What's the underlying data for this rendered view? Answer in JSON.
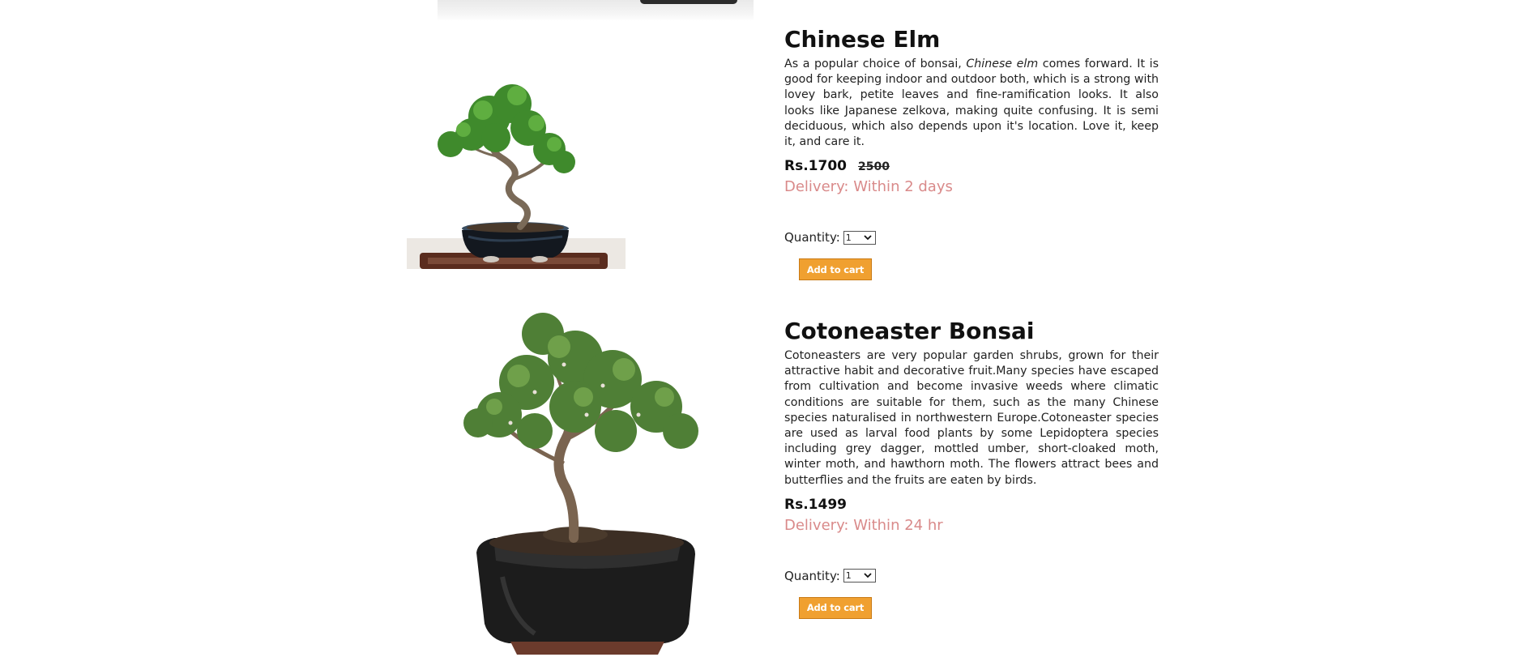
{
  "products": [
    {
      "id": "chinese-elm",
      "title": "Chinese Elm",
      "description_pre": "As a popular choice of bonsai, ",
      "description_em": "Chinese elm",
      "description_post": " comes forward. It is good for keeping indoor and outdoor both, which is a strong with lovey bark, petite leaves and fine-ramification looks. It also looks like Japanese zelkova, making quite confusing. It is semi deciduous, which also depends upon it's location. Love it, keep it, and care it.",
      "price": "Rs.1700",
      "old_price": "2500",
      "delivery": "Delivery: Within 2 days",
      "quantity_label": "Quantity:",
      "quantity_value": "1",
      "add_to_cart_label": "Add to cart"
    },
    {
      "id": "cotoneaster-bonsai",
      "title": "Cotoneaster Bonsai",
      "description": "Cotoneasters are very popular garden shrubs, grown for their attractive habit and decorative fruit.Many species have escaped from cultivation and become invasive weeds where climatic conditions are suitable for them, such as the many Chinese species naturalised in northwestern Europe.Cotoneaster species are used as larval food plants by some Lepidoptera species including grey dagger, mottled umber, short-cloaked moth, winter moth, and hawthorn moth. The flowers attract bees and butterflies and the fruits are eaten by birds.",
      "price": "Rs.1499",
      "delivery": "Delivery: Within 24 hr",
      "quantity_label": "Quantity:",
      "quantity_value": "1",
      "add_to_cart_label": "Add to cart"
    }
  ],
  "colors": {
    "delivery": "#d98a8a",
    "add_to_cart_bg": "#f0a030",
    "add_to_cart_border": "#c97a14",
    "title": "#111111",
    "body_text": "#222222"
  }
}
